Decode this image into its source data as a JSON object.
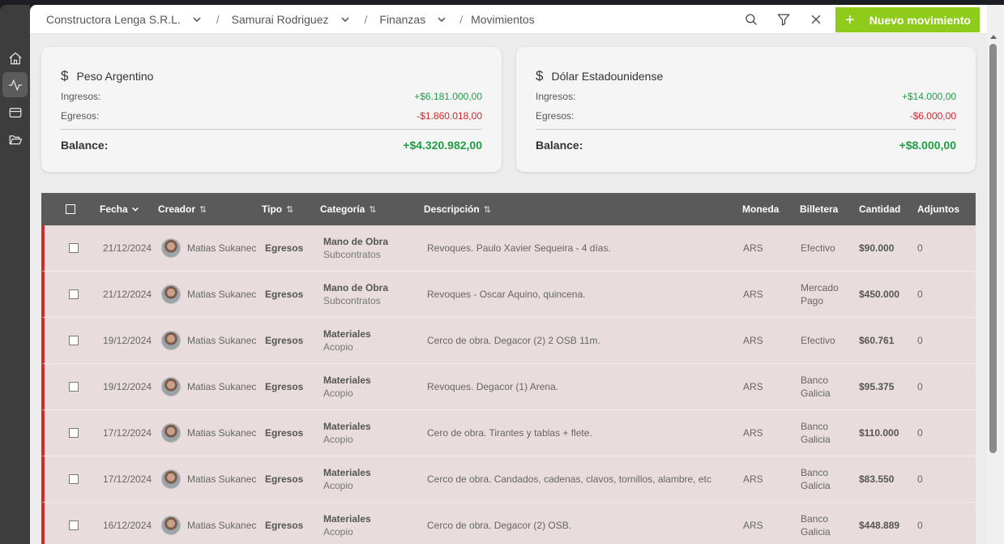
{
  "breadcrumb": {
    "company": "Constructora Lenga S.R.L.",
    "project": "Samurai Rodriguez",
    "section": "Finanzas",
    "page": "Movimientos"
  },
  "header": {
    "new_button_label": "Nuevo movimiento",
    "new_button_icon": "+"
  },
  "sidebar": {
    "items": [
      "home-icon",
      "activity-icon",
      "card-icon",
      "folder-icon"
    ],
    "active": "activity-icon"
  },
  "summary": [
    {
      "title": "Peso Argentino",
      "icon": "$",
      "ingresos_label": "Ingresos:",
      "ingresos": "+$6.181.000,00",
      "egresos_label": "Egresos:",
      "egresos": "-$1.860.018,00",
      "balance_label": "Balance:",
      "balance": "+$4.320.982,00"
    },
    {
      "title": "Dólar Estadounidense",
      "icon": "$",
      "ingresos_label": "Ingresos:",
      "ingresos": "+$14.000,00",
      "egresos_label": "Egresos:",
      "egresos": "-$6.000,00",
      "balance_label": "Balance:",
      "balance": "+$8.000,00"
    }
  ],
  "table": {
    "columns": {
      "fecha": "Fecha",
      "creador": "Creador",
      "tipo": "Tipo",
      "categoria": "Categoría",
      "descripcion": "Descripción",
      "moneda": "Moneda",
      "billetera": "Billetera",
      "cantidad": "Cantidad",
      "adjuntos": "Adjuntos"
    },
    "sort_glyph": "⇅",
    "rows": [
      {
        "fecha": "21/12/2024",
        "creador": "Matias Sukanec",
        "tipo": "Egresos",
        "categoria": "Mano de Obra",
        "subcategoria": "Subcontratos",
        "descripcion": "Revoques. Paulo Xavier Sequeira - 4 días.",
        "moneda": "ARS",
        "billetera_1": "Efectivo",
        "billetera_2": "",
        "cantidad": "$90.000",
        "adjuntos": "0"
      },
      {
        "fecha": "21/12/2024",
        "creador": "Matias Sukanec",
        "tipo": "Egresos",
        "categoria": "Mano de Obra",
        "subcategoria": "Subcontratos",
        "descripcion": "Revoques - Oscar Aquino, quincena.",
        "moneda": "ARS",
        "billetera_1": "Mercado",
        "billetera_2": "Pago",
        "cantidad": "$450.000",
        "adjuntos": "0"
      },
      {
        "fecha": "19/12/2024",
        "creador": "Matias Sukanec",
        "tipo": "Egresos",
        "categoria": "Materiales",
        "subcategoria": "Acopio",
        "descripcion": "Cerco de obra. Degacor (2) 2 OSB 11m.",
        "moneda": "ARS",
        "billetera_1": "Efectivo",
        "billetera_2": "",
        "cantidad": "$60.761",
        "adjuntos": "0"
      },
      {
        "fecha": "19/12/2024",
        "creador": "Matias Sukanec",
        "tipo": "Egresos",
        "categoria": "Materiales",
        "subcategoria": "Acopio",
        "descripcion": "Revoques. Degacor (1) Arena.",
        "moneda": "ARS",
        "billetera_1": "Banco",
        "billetera_2": "Galicia",
        "cantidad": "$95.375",
        "adjuntos": "0"
      },
      {
        "fecha": "17/12/2024",
        "creador": "Matias Sukanec",
        "tipo": "Egresos",
        "categoria": "Materiales",
        "subcategoria": "Acopio",
        "descripcion": "Cero de obra. Tirantes y tablas + flete.",
        "moneda": "ARS",
        "billetera_1": "Banco",
        "billetera_2": "Galicia",
        "cantidad": "$110.000",
        "adjuntos": "0"
      },
      {
        "fecha": "17/12/2024",
        "creador": "Matias Sukanec",
        "tipo": "Egresos",
        "categoria": "Materiales",
        "subcategoria": "Acopio",
        "descripcion": "Cerco de obra. Candados, cadenas, clavos, tornillos, alambre, etc",
        "moneda": "ARS",
        "billetera_1": "Banco",
        "billetera_2": "Galicia",
        "cantidad": "$83.550",
        "adjuntos": "0"
      },
      {
        "fecha": "16/12/2024",
        "creador": "Matias Sukanec",
        "tipo": "Egresos",
        "categoria": "Materiales",
        "subcategoria": "Acopio",
        "descripcion": "Cerco de obra. Degacor (2) OSB.",
        "moneda": "ARS",
        "billetera_1": "Banco",
        "billetera_2": "Galicia",
        "cantidad": "$448.889",
        "adjuntos": "0"
      }
    ]
  },
  "colors": {
    "accent": "#8fcb1b",
    "positive": "#1e9e45",
    "negative": "#d8232a",
    "row_marker": "#d32a2a",
    "table_header": "#5a5a5a"
  }
}
